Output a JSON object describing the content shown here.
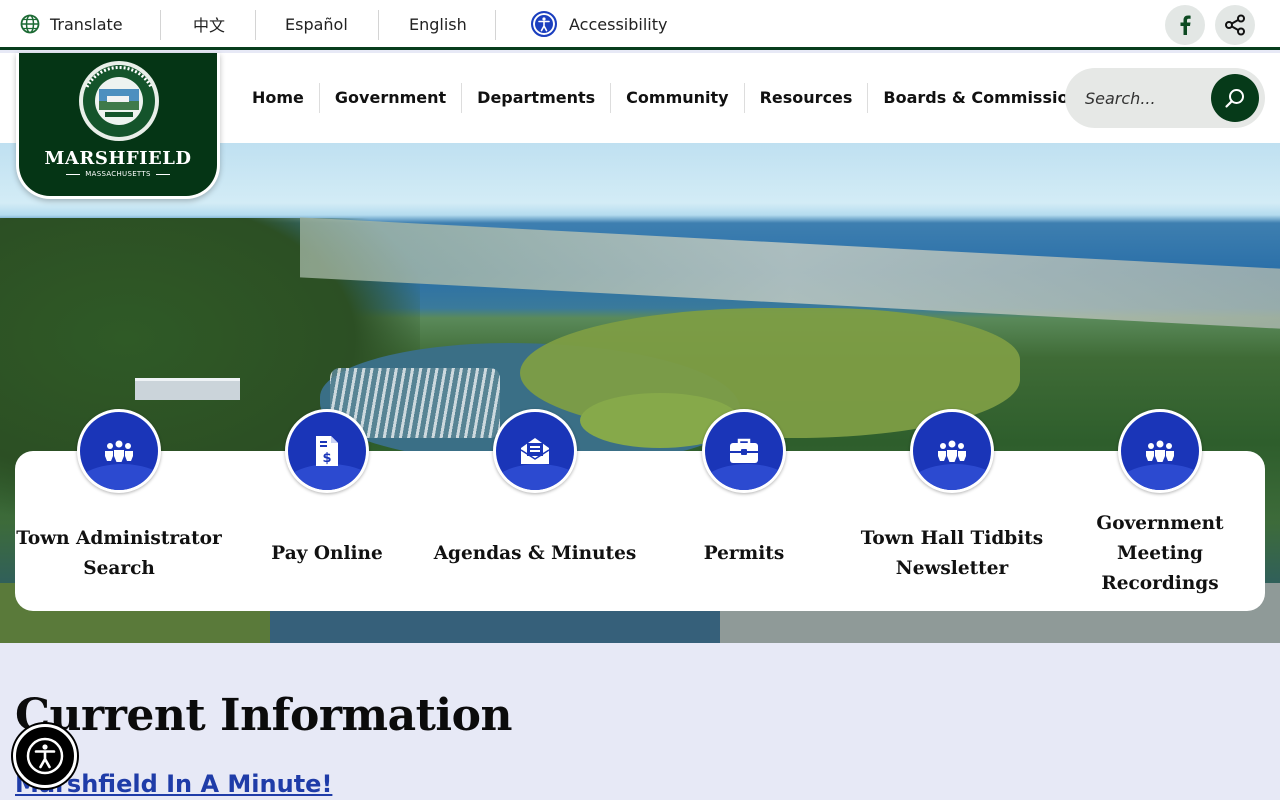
{
  "utility": {
    "translate": "Translate",
    "lang_zh": "中文",
    "lang_es": "Español",
    "lang_en": "English",
    "accessibility": "Accessibility"
  },
  "logo": {
    "name": "MARSHFIELD",
    "sub": "MASSACHUSETTS"
  },
  "nav": [
    "Home",
    "Government",
    "Departments",
    "Community",
    "Resources",
    "Boards & Commissions"
  ],
  "search": {
    "placeholder": "Search..."
  },
  "quick_links": [
    {
      "label": "Town Administrator Search",
      "icon": "people-group-icon"
    },
    {
      "label": "Pay Online",
      "icon": "invoice-dollar-icon"
    },
    {
      "label": "Agendas & Minutes",
      "icon": "envelope-open-icon"
    },
    {
      "label": "Permits",
      "icon": "briefcase-icon"
    },
    {
      "label": "Town Hall Tidbits Newsletter",
      "icon": "people-group-icon"
    },
    {
      "label": "Government Meeting Recordings",
      "icon": "people-group-icon"
    }
  ],
  "current_info": {
    "title": "Current Information",
    "link": "Marshfield In A Minute!"
  },
  "colors": {
    "brand_green": "#073d1c",
    "accent_blue": "#1a35b8"
  }
}
